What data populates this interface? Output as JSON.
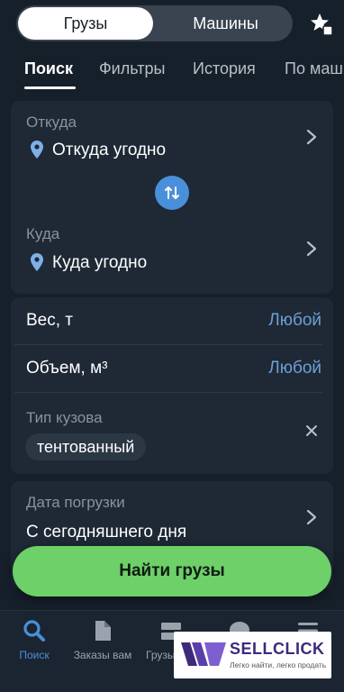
{
  "segment": {
    "active": "Грузы",
    "inactive": "Машины"
  },
  "tabs": [
    {
      "label": "Поиск",
      "active": true
    },
    {
      "label": "Фильтры",
      "active": false
    },
    {
      "label": "История",
      "active": false
    },
    {
      "label": "По маш",
      "active": false
    }
  ],
  "route": {
    "from_label": "Откуда",
    "from_value": "Откуда угодно",
    "to_label": "Куда",
    "to_value": "Куда угодно"
  },
  "params": {
    "weight_label": "Вес, т",
    "weight_value": "Любой",
    "volume_label": "Объем, м³",
    "volume_value": "Любой",
    "body_label": "Тип кузова",
    "body_chip": "тентованный"
  },
  "date": {
    "label": "Дата погрузки",
    "value": "С сегодняшнего дня"
  },
  "find_button": "Найти грузы",
  "nav": [
    {
      "label": "Поиск",
      "icon": "search-icon",
      "active": true
    },
    {
      "label": "Заказы вам",
      "icon": "document-icon",
      "active": false
    },
    {
      "label": "Грузы",
      "icon": "cargo-icon",
      "active": false
    },
    {
      "label": "",
      "icon": "chat-icon",
      "active": false
    },
    {
      "label": "",
      "icon": "menu-icon",
      "active": false
    }
  ],
  "watermark": {
    "title": "SELLCLICK",
    "subtitle": "Легко найти, легко продать"
  },
  "colors": {
    "background": "#16202b",
    "card": "#1e2935",
    "accent_blue": "#4a8fd9",
    "link_blue": "#6f9fd6",
    "button_green": "#6dd068"
  }
}
